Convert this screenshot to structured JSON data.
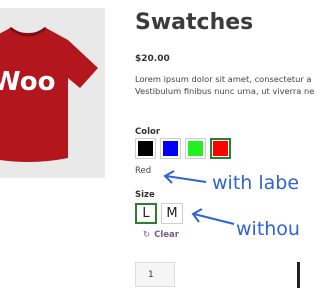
{
  "product": {
    "title": "Swatches",
    "price": "$20.00",
    "description_lines": [
      "Lorem ipsum dolor sit amet, consectetur a",
      "Vestibulum finibus nunc urna, ut viverra ne"
    ],
    "image_text": "Woo",
    "shirt_color": "#b3171d"
  },
  "color_attribute": {
    "label": "Color",
    "swatches": [
      {
        "name": "black-swatch",
        "color": "#000000",
        "selected": false
      },
      {
        "name": "blue-swatch",
        "color": "#0000ff",
        "selected": false
      },
      {
        "name": "green-swatch",
        "color": "#22f01f",
        "selected": false
      },
      {
        "name": "red-swatch",
        "color": "#ff0000",
        "selected": true
      }
    ],
    "selected_name": "Red"
  },
  "size_attribute": {
    "label": "Size",
    "options": [
      "L",
      "M"
    ],
    "selected": "L",
    "clear_label": "Clear"
  },
  "quantity": {
    "value": "1"
  },
  "annotations": {
    "with_label": "with labe",
    "without": "withou",
    "color": "#2f63d6"
  },
  "colors": {
    "selected_border": "#2e7d32",
    "clear_link": "#7b5a8f"
  }
}
